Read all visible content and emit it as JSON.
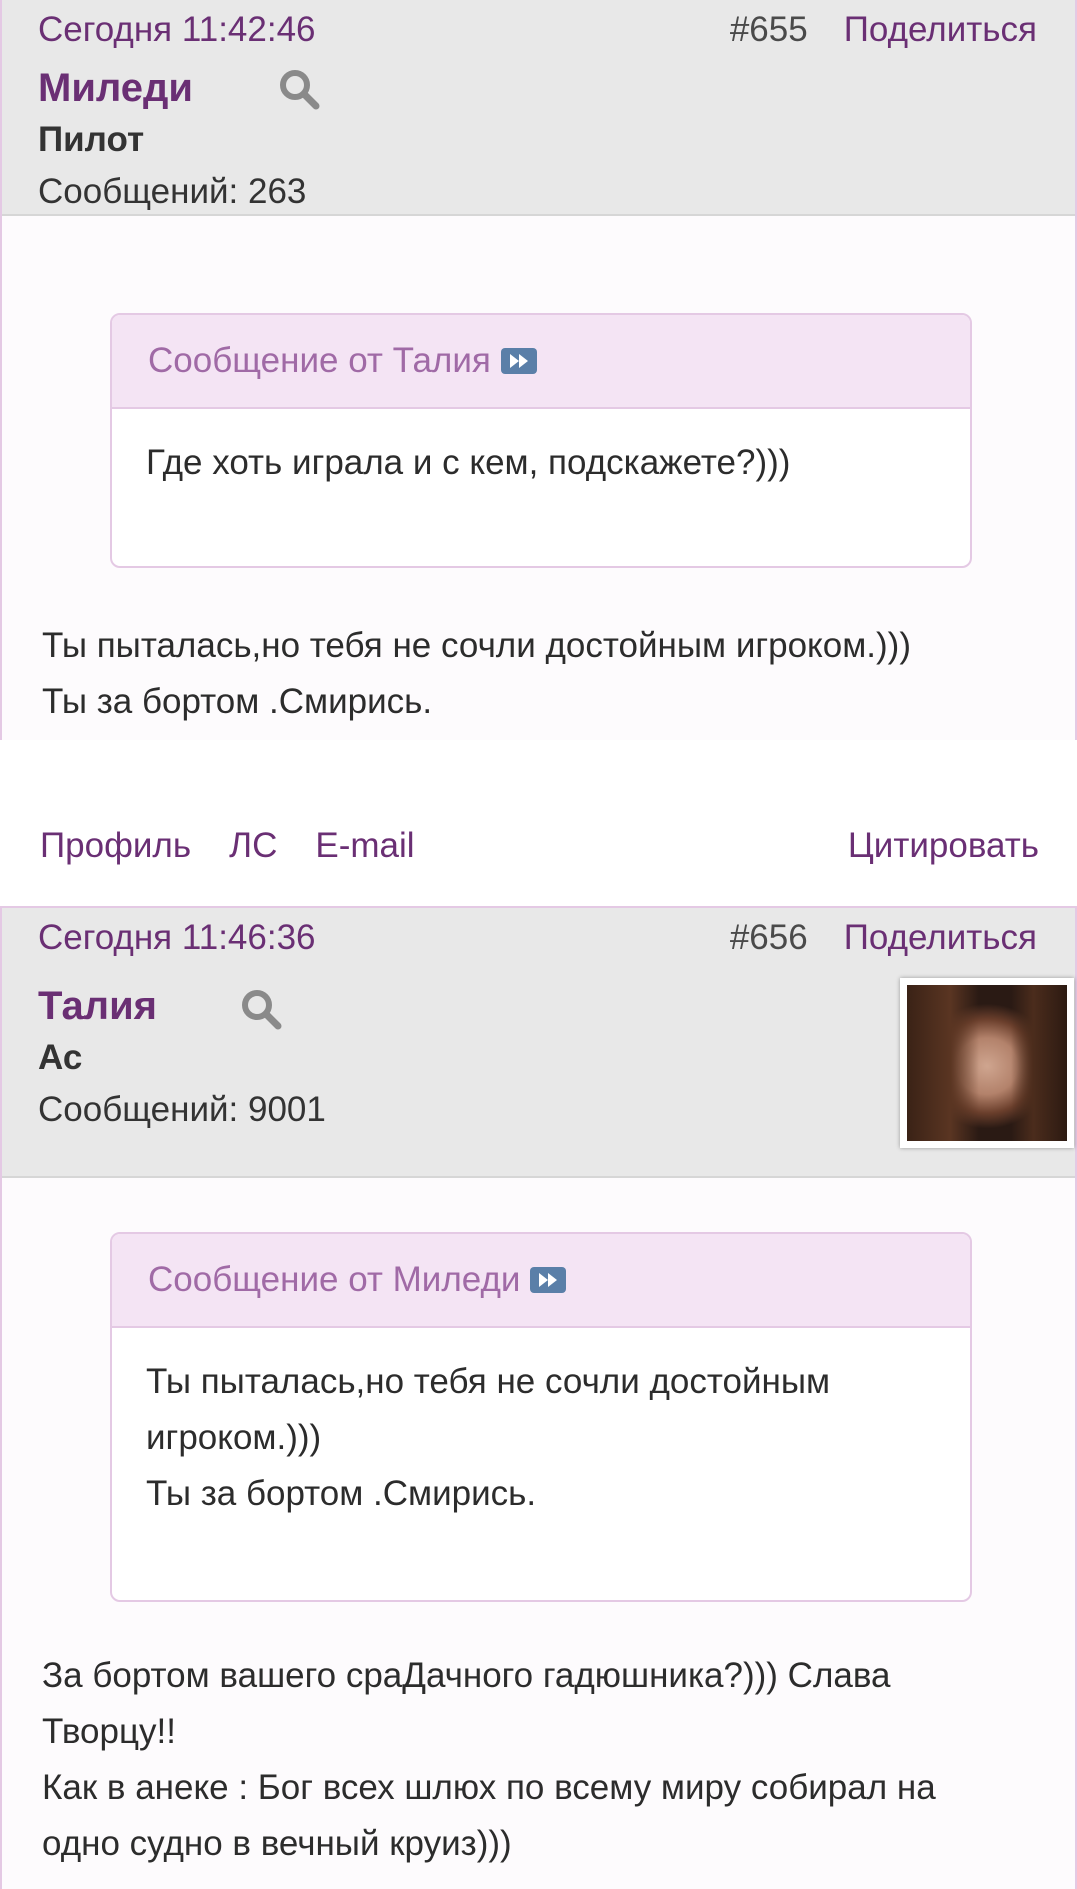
{
  "posts": [
    {
      "date": "Сегодня 11:42:46",
      "number": "#655",
      "share": "Поделиться",
      "author": "Миледи",
      "rank": "Пилот",
      "messages": "Сообщений: 263",
      "quote_header": "Сообщение от Талия",
      "quote_lines": [
        "Где хоть играла и с кем, подскажете?)))"
      ],
      "text_lines": [
        "Ты пыталась,но тебя не сочли достойным игроком.)))",
        "Ты за бортом .Смирись."
      ],
      "footer": {
        "profile": "Профиль",
        "pm": "ЛС",
        "email": "E-mail",
        "quote": "Цитировать"
      }
    },
    {
      "date": "Сегодня 11:46:36",
      "number": "#656",
      "share": "Поделиться",
      "author": "Талия",
      "rank": "Ас",
      "messages": "Сообщений: 9001",
      "quote_header": "Сообщение от Миледи",
      "quote_lines": [
        "Ты пыталась,но тебя не сочли достойным",
        "игроком.)))",
        "Ты за бортом .Смирись."
      ],
      "text_lines": [
        "За бортом вашего сраДачного гадюшника?))) Слава",
        "Творцу!!",
        "Как в анеке : Бог всех шлюх по всему миру собирал на",
        "одно судно в вечный круиз)))"
      ]
    }
  ],
  "icons": {
    "search": "search-icon",
    "goto": "goto-post-icon",
    "avatar": "avatar"
  },
  "colors": {
    "accent": "#6a2f74",
    "quote_header_bg": "#f4e4f4",
    "quote_header_text": "#a06aa6",
    "header_bg": "#e8e8e8"
  }
}
